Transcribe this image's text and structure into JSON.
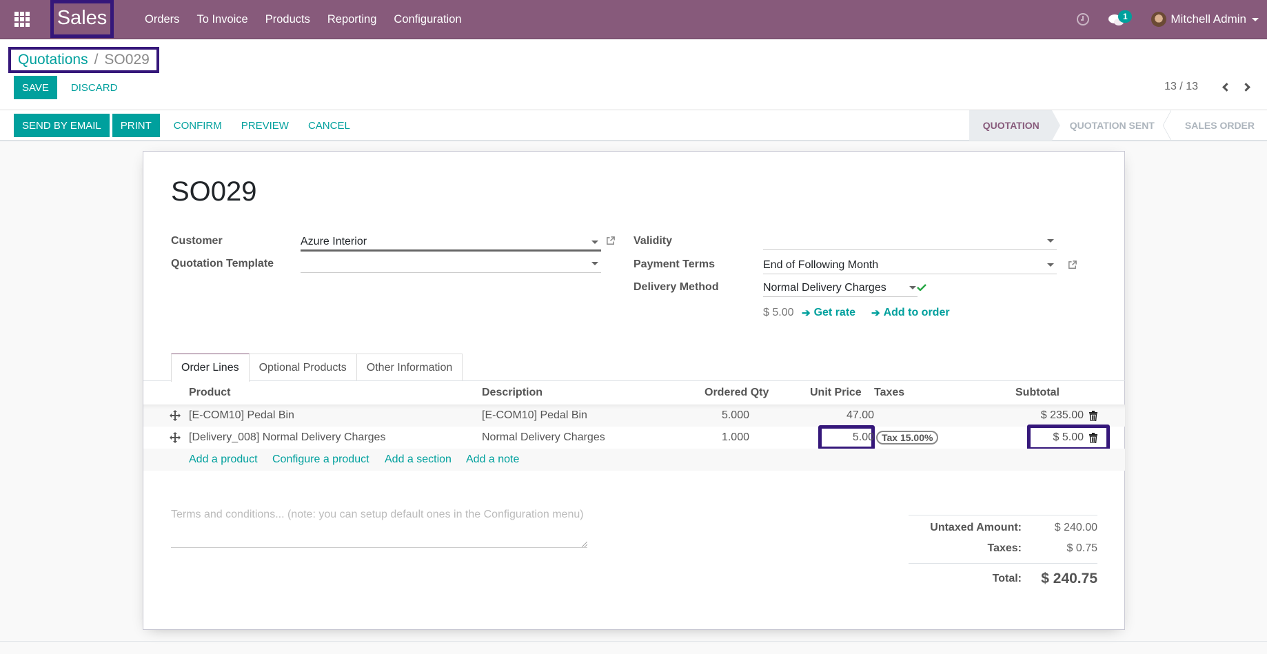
{
  "navbar": {
    "app_name": "Sales",
    "menu": [
      "Orders",
      "To Invoice",
      "Products",
      "Reporting",
      "Configuration"
    ],
    "message_count": "1",
    "user_name": "Mitchell Admin"
  },
  "breadcrumb": {
    "parent": "Quotations",
    "separator": "/",
    "current": "SO029"
  },
  "toolbar": {
    "save_label": "SAVE",
    "discard_label": "DISCARD",
    "pager": "13 / 13"
  },
  "actions": {
    "send_by_email": "SEND BY EMAIL",
    "print": "PRINT",
    "confirm": "CONFIRM",
    "preview": "PREVIEW",
    "cancel": "CANCEL"
  },
  "stages": [
    "QUOTATION",
    "QUOTATION SENT",
    "SALES ORDER"
  ],
  "active_stage": "QUOTATION",
  "form": {
    "title": "SO029",
    "customer_label": "Customer",
    "customer_value": "Azure Interior",
    "template_label": "Quotation Template",
    "template_value": "",
    "validity_label": "Validity",
    "validity_value": "",
    "payment_terms_label": "Payment Terms",
    "payment_terms_value": "End of Following Month",
    "delivery_method_label": "Delivery Method",
    "delivery_method_value": "Normal Delivery Charges",
    "delivery_amount": "$ 5.00",
    "get_rate_label": "Get rate",
    "add_to_order_label": "Add to order"
  },
  "tabs": [
    "Order Lines",
    "Optional Products",
    "Other Information"
  ],
  "order_lines": {
    "columns": [
      "Product",
      "Description",
      "Ordered Qty",
      "Unit Price",
      "Taxes",
      "Subtotal"
    ],
    "rows": [
      {
        "product": "[E-COM10] Pedal Bin",
        "description": "[E-COM10] Pedal Bin",
        "qty": "5.000",
        "unit_price": "47.00",
        "taxes": "",
        "subtotal": "$ 235.00"
      },
      {
        "product": "[Delivery_008] Normal Delivery Charges",
        "description": "Normal Delivery Charges",
        "qty": "1.000",
        "unit_price": "5.00",
        "taxes": "Tax 15.00%",
        "subtotal": "$ 5.00"
      }
    ],
    "add_links": [
      "Add a product",
      "Configure a product",
      "Add a section",
      "Add a note"
    ]
  },
  "notes": {
    "placeholder": "Terms and conditions... (note: you can setup default ones in the Configuration menu)"
  },
  "totals": {
    "untaxed_label": "Untaxed Amount:",
    "untaxed_value": "$ 240.00",
    "taxes_label": "Taxes:",
    "taxes_value": "$ 0.75",
    "total_label": "Total:",
    "total_value": "$ 240.75"
  },
  "colors": {
    "brand": "#875a7b",
    "accent": "#00a09d",
    "highlight_box": "#35177a"
  }
}
